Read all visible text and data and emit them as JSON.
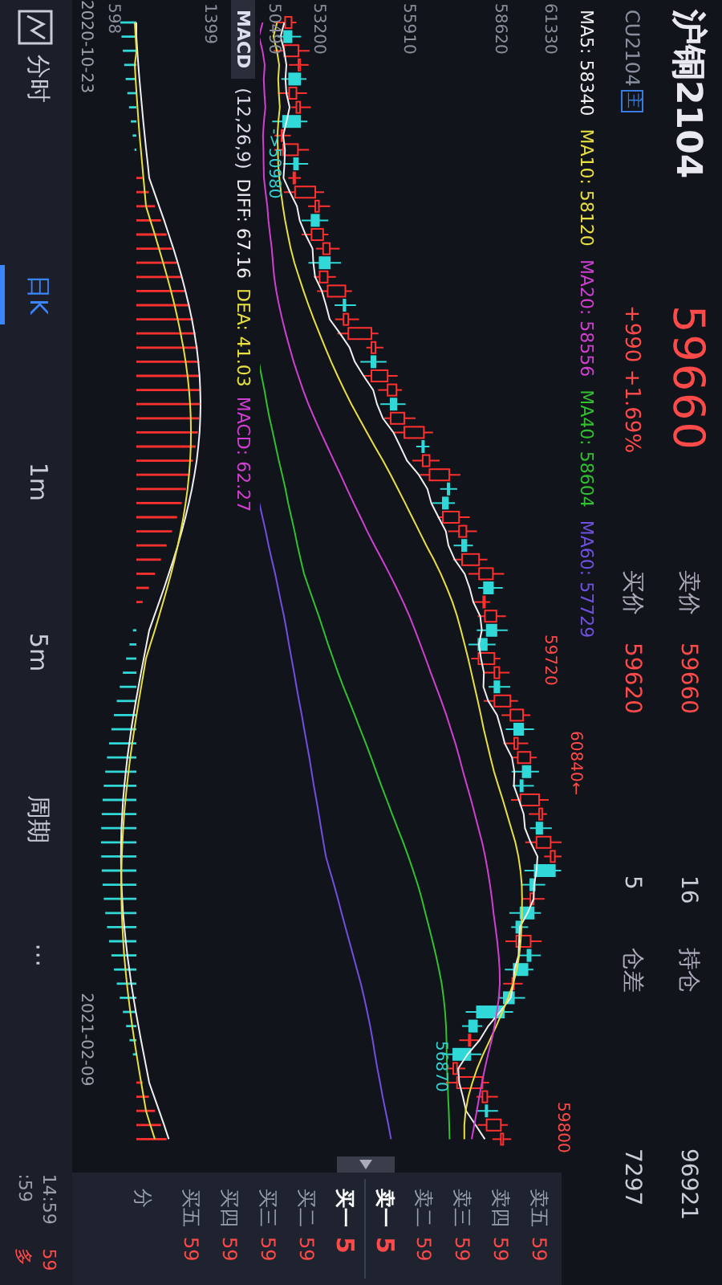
{
  "header": {
    "title": "沪铜2104",
    "code": "CU2104",
    "badge": "主",
    "price": "59660",
    "change": "+990",
    "change_percent": "+1.69%"
  },
  "quotes": [
    {
      "label": "卖价",
      "price": "59660",
      "volume": "16",
      "stat_label": "持仓",
      "stat_value": "96921"
    },
    {
      "label": "买价",
      "price": "59620",
      "volume": "5",
      "stat_label": "仓差",
      "stat_value": "7297"
    }
  ],
  "ma_legend": [
    {
      "text": "MA5: 58340",
      "color": "#f0f0f0"
    },
    {
      "text": "MA10: 58120",
      "color": "#e8e040"
    },
    {
      "text": "MA20: 58556",
      "color": "#d040d0"
    },
    {
      "text": "MA40: 58604",
      "color": "#30c030"
    },
    {
      "text": "MA60: 57729",
      "color": "#7050e0"
    }
  ],
  "price_axis": [
    "61330",
    "58620",
    "55910",
    "53200",
    "50490"
  ],
  "chart_labels": [
    {
      "text": "59720",
      "kind": "up"
    },
    {
      "text": "60840←",
      "kind": "up"
    },
    {
      "text": "59800",
      "kind": "up"
    },
    {
      "text": "56870",
      "kind": "down"
    },
    {
      "text": "->50980",
      "kind": "down"
    }
  ],
  "macd": {
    "title": "MACD",
    "params": "(12,26,9)",
    "values": [
      {
        "text": "DIFF: 67.16",
        "color": "#f0f0f0"
      },
      {
        "text": "DEA: 41.03",
        "color": "#e8e040"
      },
      {
        "text": "MACD: 62.27",
        "color": "#d040d0"
      }
    ],
    "axis": [
      "1399",
      "598"
    ]
  },
  "dates": [
    "2020-10-23",
    "2021-02-09"
  ],
  "tabs": [
    {
      "label": "分时",
      "selected": false
    },
    {
      "label": "日K",
      "selected": true
    },
    {
      "label": "1m",
      "selected": false
    },
    {
      "label": "5m",
      "selected": false
    },
    {
      "label": "周期",
      "selected": false
    },
    {
      "label": "⋯",
      "selected": false
    }
  ],
  "order_book": {
    "rows": [
      {
        "label": "卖五",
        "value": "59",
        "emphasized": false
      },
      {
        "label": "卖四",
        "value": "59",
        "emphasized": false
      },
      {
        "label": "卖三",
        "value": "59",
        "emphasized": false
      },
      {
        "label": "卖二",
        "value": "59",
        "emphasized": false
      },
      {
        "label": "卖一",
        "value": "5",
        "emphasized": true
      },
      {
        "label": "买一",
        "value": "5",
        "emphasized": true
      },
      {
        "label": "买二",
        "value": "59",
        "emphasized": false
      },
      {
        "label": "买三",
        "value": "59",
        "emphasized": false
      },
      {
        "label": "买四",
        "value": "59",
        "emphasized": false
      },
      {
        "label": "买五",
        "value": "59",
        "emphasized": false
      }
    ],
    "footer": "分"
  },
  "trades": [
    {
      "time": "14:59",
      "value": "59"
    },
    {
      "time": ":59",
      "value": "多"
    }
  ]
}
